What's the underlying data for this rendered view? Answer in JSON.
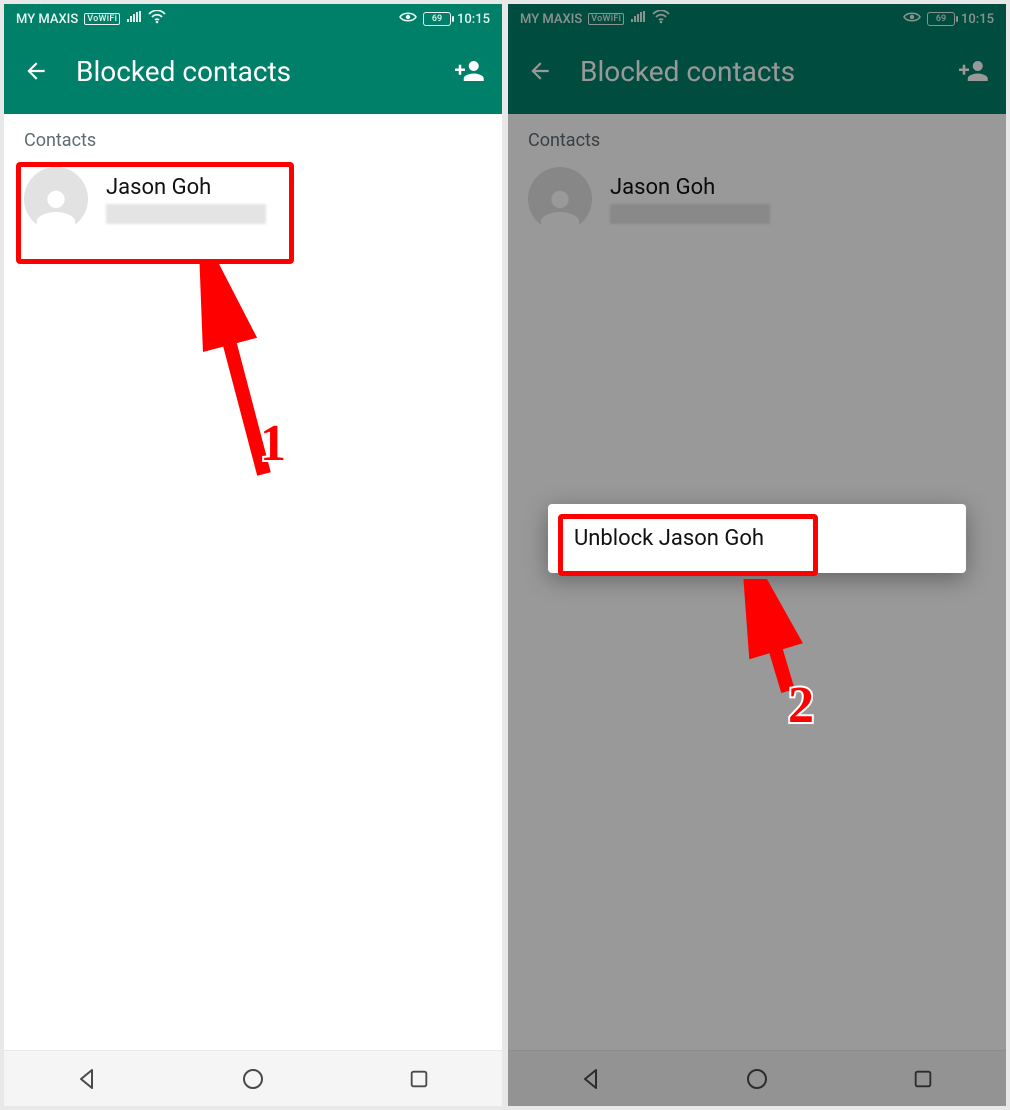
{
  "status": {
    "carrier": "MY MAXIS",
    "vowifi": "VoWiFi",
    "battery": "69",
    "time": "10:15"
  },
  "appbar": {
    "title": "Blocked contacts"
  },
  "section": {
    "label": "Contacts"
  },
  "contacts": [
    {
      "name": "Jason Goh"
    }
  ],
  "menu": {
    "unblock": "Unblock Jason Goh"
  },
  "annotations": {
    "step1": "1",
    "step2": "2"
  }
}
